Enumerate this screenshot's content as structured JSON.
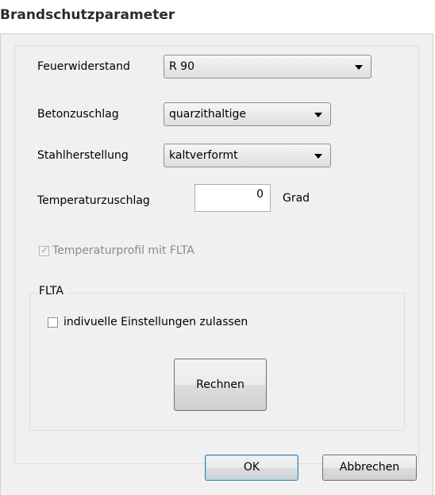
{
  "window": {
    "title": "Brandschutzparameter"
  },
  "fields": {
    "feuerwiderstand": {
      "label": "Feuerwiderstand",
      "value": "R 90"
    },
    "betonzuschlag": {
      "label": "Betonzuschlag",
      "value": "quarzithaltige"
    },
    "stahlherstellung": {
      "label": "Stahlherstellung",
      "value": "kaltverformt"
    },
    "temperaturzuschlag": {
      "label": "Temperaturzuschlag",
      "value": "0",
      "unit": "Grad"
    }
  },
  "temperaturprofil": {
    "label": "Temperaturprofil mit FLTA",
    "checked": true,
    "enabled": false
  },
  "flta_group": {
    "title": "FLTA",
    "checkbox_label": "indivuelle Einstellungen zulassen",
    "checked": false,
    "rechnen_label": "Rechnen"
  },
  "buttons": {
    "ok": "OK",
    "abbrechen": "Abbrechen"
  }
}
